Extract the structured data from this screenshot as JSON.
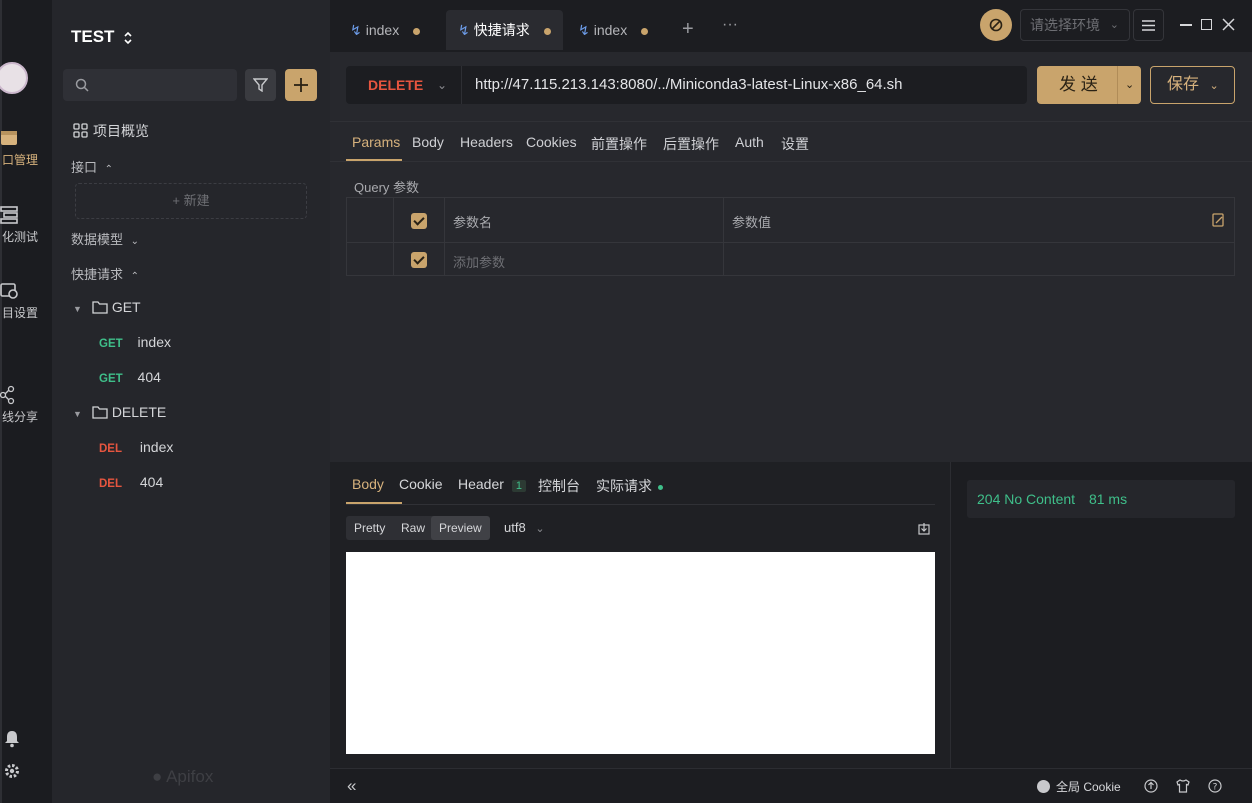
{
  "project": {
    "title": "TEST"
  },
  "rail": {
    "items": [
      {
        "label": "口管理",
        "icon": "api-manage-icon"
      },
      {
        "label": "化测试",
        "icon": "auto-test-icon"
      },
      {
        "label": "目设置",
        "icon": "project-settings-icon"
      },
      {
        "label": "线分享",
        "icon": "share-icon"
      }
    ]
  },
  "tree": {
    "overview": "项目概览",
    "interfaces": "接口",
    "new_label": "新建",
    "data_models": "数据模型",
    "quick_requests": "快捷请求",
    "folders": [
      {
        "name": "GET",
        "items": [
          {
            "method": "GET",
            "name": "index"
          },
          {
            "method": "GET",
            "name": "404"
          }
        ]
      },
      {
        "name": "DELETE",
        "items": [
          {
            "method": "DEL",
            "name": "index"
          },
          {
            "method": "DEL",
            "name": "404"
          }
        ]
      }
    ],
    "logo": "Apifox"
  },
  "tabs": [
    {
      "label": "index"
    },
    {
      "label": "快捷请求"
    },
    {
      "label": "index"
    }
  ],
  "env": {
    "placeholder": "请选择环境"
  },
  "request": {
    "method": "DELETE",
    "url": "http://47.115.213.143:8080/../Miniconda3-latest-Linux-x86_64.sh",
    "send": "发 送",
    "save": "保存"
  },
  "param_tabs": [
    "Params",
    "Body",
    "Headers",
    "Cookies",
    "前置操作",
    "后置操作",
    "Auth",
    "设置"
  ],
  "query": {
    "label": "Query 参数",
    "col_name": "参数名",
    "col_value": "参数值",
    "add_placeholder": "添加参数"
  },
  "response": {
    "tabs": [
      "Body",
      "Cookie",
      "Header",
      "控制台",
      "实际请求"
    ],
    "header_count": "1",
    "formats": [
      "Pretty",
      "Raw",
      "Preview"
    ],
    "encoding": "utf8",
    "status": "204 No Content",
    "time": "81 ms"
  },
  "bottom": {
    "cookie": "全局 Cookie"
  },
  "colors": {
    "accent": "#c9a46c",
    "get": "#3fbf8a",
    "delete": "#e6553f"
  }
}
